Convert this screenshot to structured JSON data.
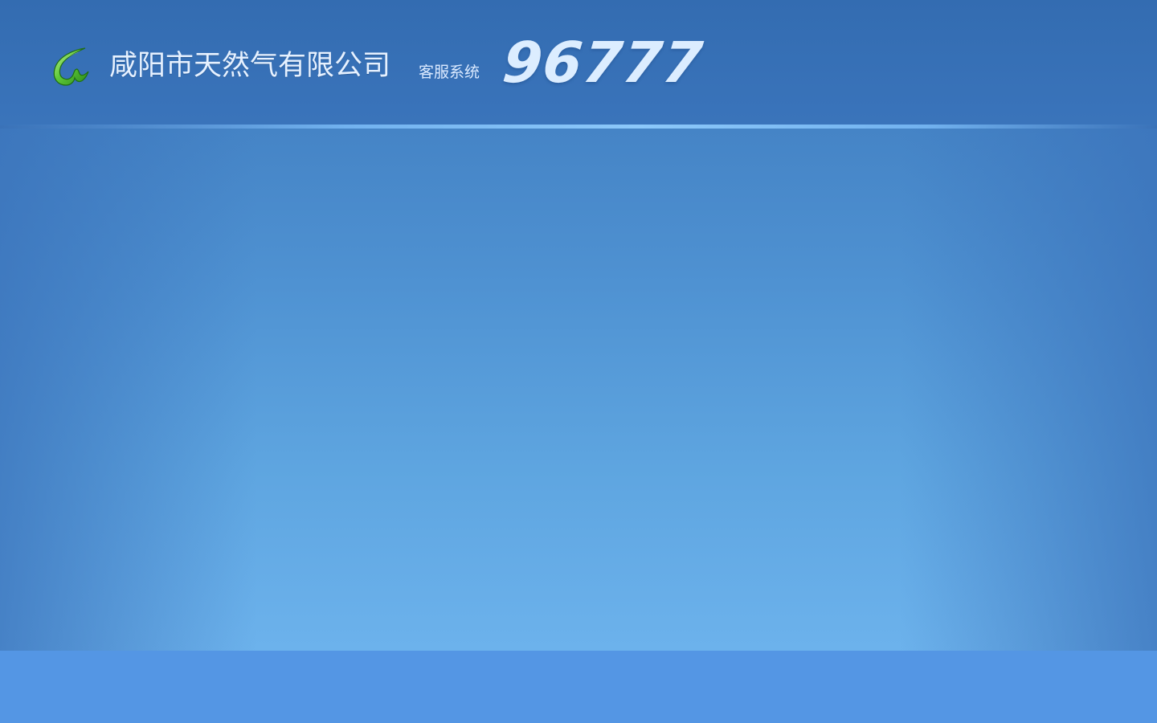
{
  "header": {
    "logo_icon": "company-logo-icon",
    "company_name": "咸阳市天然气有限公司",
    "system_label": "客服系统",
    "hotline": "96777"
  },
  "colors": {
    "header_bg": "#336cb1",
    "content_top": "#4584c6",
    "content_bottom": "#6cb2ec",
    "footer_bg": "#5496e4",
    "header_text": "#e6f1ff",
    "logo_green": "#5fc93a"
  }
}
